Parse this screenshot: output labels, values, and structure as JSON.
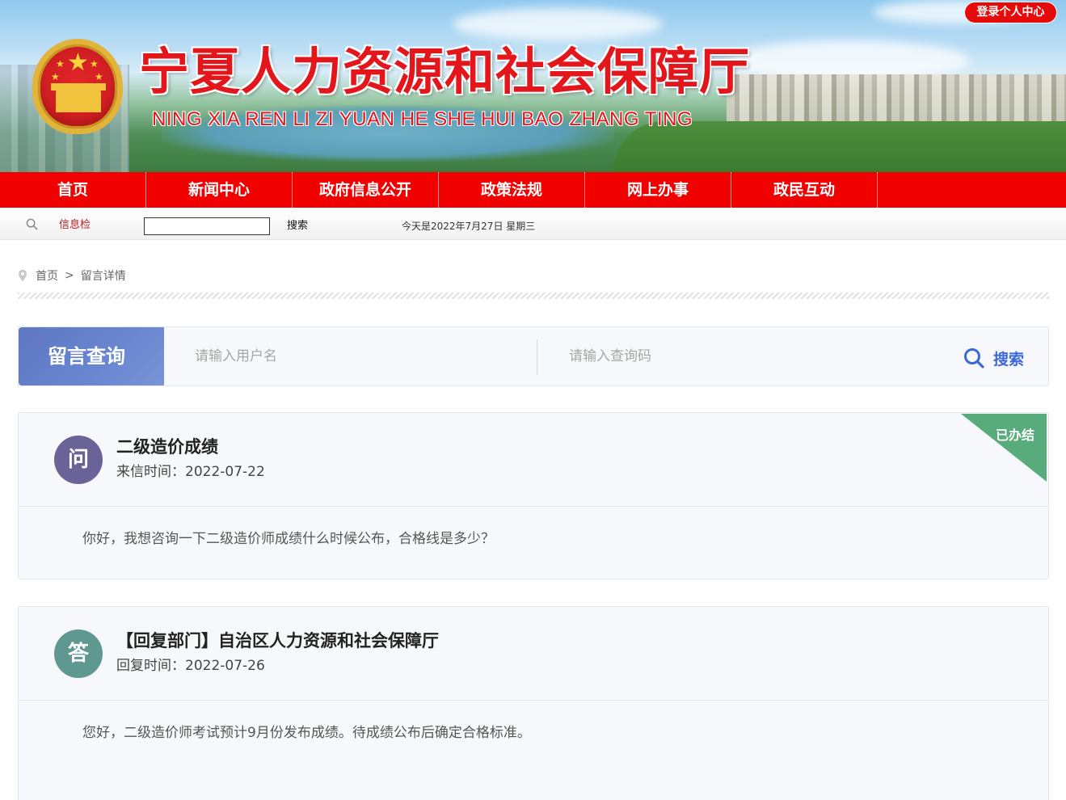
{
  "header": {
    "site_title": "宁夏人力资源和社会保障厅",
    "site_subtitle": "NING XIA REN LI ZI YUAN HE SHE HUI BAO ZHANG TING",
    "login_label": "登录个人中心"
  },
  "nav": {
    "items": [
      {
        "label": "首页"
      },
      {
        "label": "新闻中心"
      },
      {
        "label": "政府信息公开"
      },
      {
        "label": "政策法规"
      },
      {
        "label": "网上办事"
      },
      {
        "label": "政民互动"
      }
    ]
  },
  "toolbar": {
    "search_label": "信息检",
    "search_value": "",
    "search_button": "搜索",
    "date_text": "今天是2022年7月27日 星期三"
  },
  "breadcrumb": {
    "home": "首页",
    "separator": ">",
    "current": "留言详情"
  },
  "query": {
    "title": "留言查询",
    "username_placeholder": "请输入用户名",
    "code_placeholder": "请输入查询码",
    "search_label": "搜索"
  },
  "question": {
    "avatar": "问",
    "title": "二级造价成绩",
    "time_label": "来信时间：",
    "time_value": "2022-07-22",
    "status": "已办结",
    "content": "你好，我想咨询一下二级造价师成绩什么时候公布，合格线是多少？"
  },
  "answer": {
    "avatar": "答",
    "title": "【回复部门】自治区人力资源和社会保障厅",
    "time_label": "回复时间：",
    "time_value": "2022-07-26",
    "content": "您好，二级造价师考试预计9月份发布成绩。待成绩公布后确定合格标准。"
  },
  "colors": {
    "nav_red": "#f00000",
    "login_red": "#e60b0b",
    "query_blue": "#5e78c4",
    "search_blue": "#3d69d8",
    "question_avatar": "#6a6397",
    "answer_avatar": "#5e9890",
    "status_green": "#58ac7b"
  }
}
